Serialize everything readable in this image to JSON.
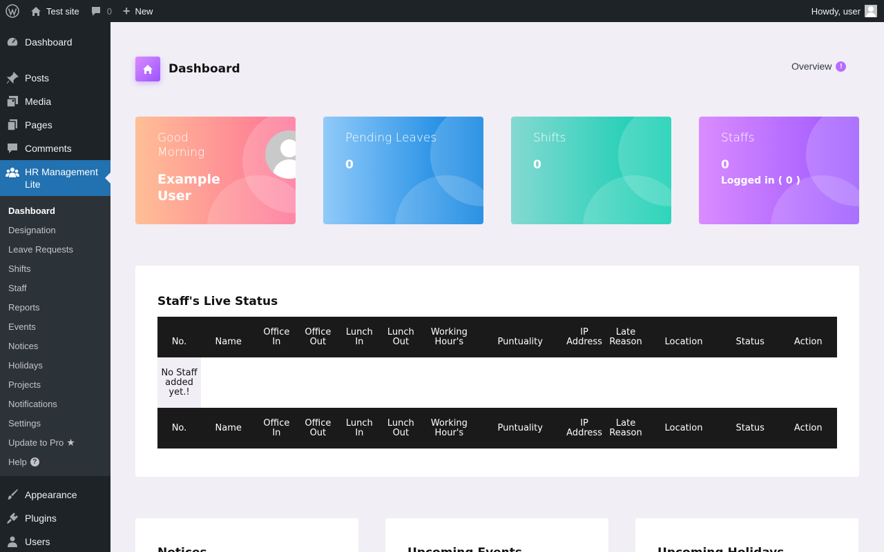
{
  "adminbar": {
    "site_name": "Test site",
    "comments_count": "0",
    "new_label": "New",
    "greeting": "Howdy, user"
  },
  "sidebar": {
    "top_items": [
      {
        "label": "Dashboard",
        "icon": "dashboard-icon"
      },
      {
        "label": "Posts",
        "icon": "pin-icon"
      },
      {
        "label": "Media",
        "icon": "media-icon"
      },
      {
        "label": "Pages",
        "icon": "pages-icon"
      },
      {
        "label": "Comments",
        "icon": "comments-icon"
      }
    ],
    "current": {
      "label": "HR Management Lite",
      "icon": "groups-icon"
    },
    "submenu": [
      "Dashboard",
      "Designation",
      "Leave Requests",
      "Shifts",
      "Staff",
      "Reports",
      "Events",
      "Notices",
      "Holidays",
      "Projects",
      "Notifications",
      "Settings",
      "Update to Pro",
      "Help"
    ],
    "bottom_items": [
      {
        "label": "Appearance",
        "icon": "brush-icon"
      },
      {
        "label": "Plugins",
        "icon": "plugin-icon"
      },
      {
        "label": "Users",
        "icon": "users-icon"
      }
    ]
  },
  "header": {
    "title": "Dashboard",
    "overview": "Overview",
    "overview_badge": "!"
  },
  "cards": {
    "greeting": {
      "label": "Good Morning",
      "name": "Example User"
    },
    "leaves": {
      "label": "Pending Leaves",
      "value": "0"
    },
    "shifts": {
      "label": "Shifts",
      "value": "0"
    },
    "staffs": {
      "label": "Staffs",
      "value": "0",
      "sub": "Logged in ( 0 )"
    }
  },
  "live_status": {
    "title": "Staff's Live Status",
    "columns": [
      "No.",
      "Name",
      "Office In",
      "Office Out",
      "Lunch In",
      "Lunch Out",
      "Working Hour's",
      "Puntuality",
      "IP Address",
      "Late Reason",
      "Location",
      "Status",
      "Action"
    ],
    "empty": "No Staff added yet.!"
  },
  "bottom": [
    "Notices",
    "Upcoming Events",
    "Upcoming Holidays"
  ],
  "colors": {
    "accent": "#2271b1",
    "purple": "#9a55ff",
    "pink": "#fe7096",
    "blue": "#047edf",
    "teal": "#07cdae"
  }
}
